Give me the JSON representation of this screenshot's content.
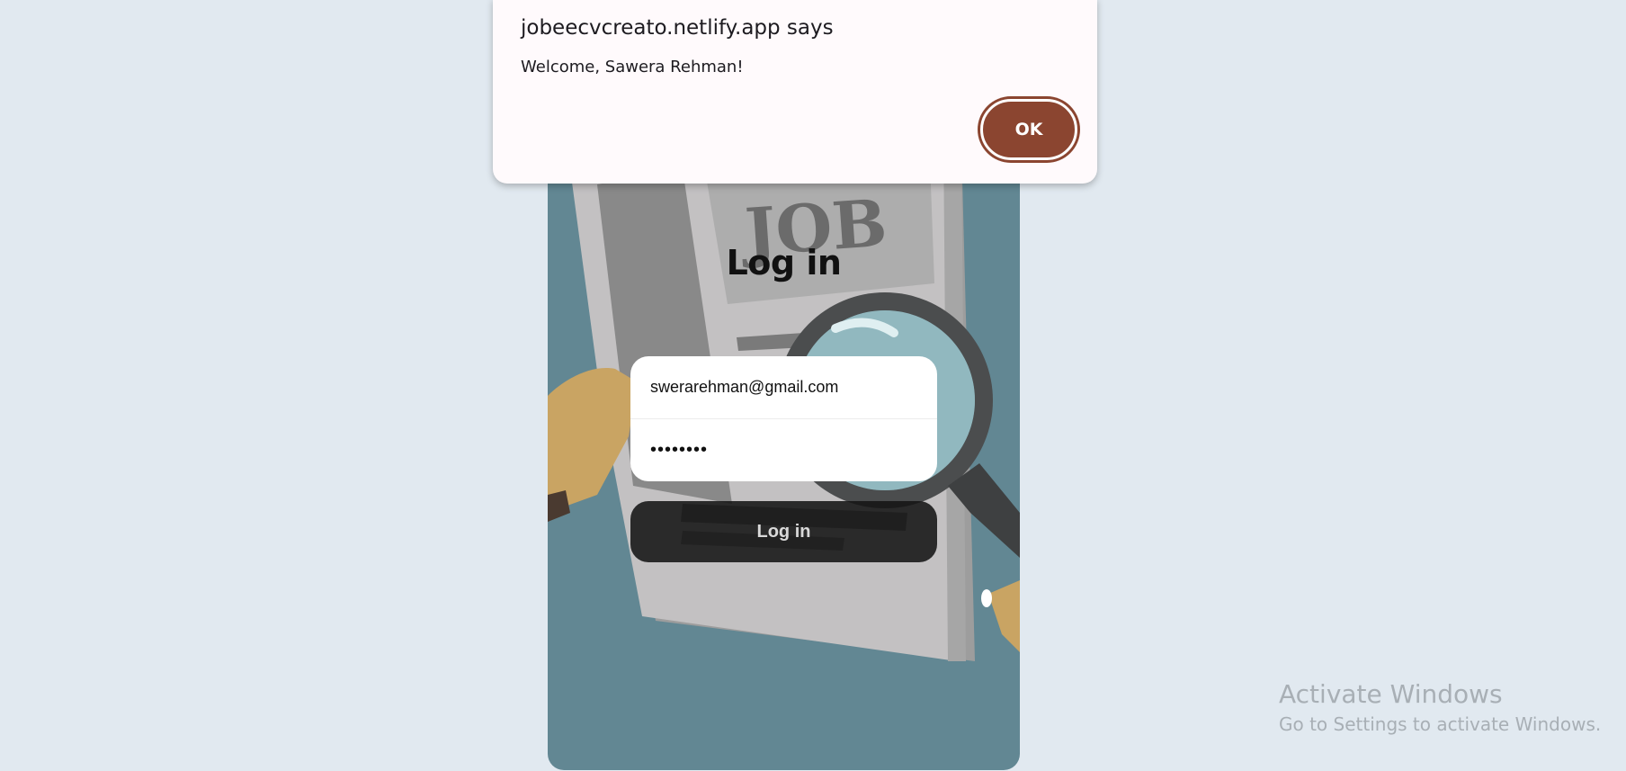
{
  "dialog": {
    "title": "jobeecvcreato.netlify.app says",
    "message": "Welcome, Sawera Rehman!",
    "ok_label": "OK"
  },
  "login": {
    "title": "Log in",
    "email_value": "swerarehman@gmail.com",
    "password_value": "********",
    "submit_label": "Log in"
  },
  "watermark": {
    "title": "Activate Windows",
    "subtitle": "Go to Settings to activate Windows."
  },
  "illustration": {
    "newspaper_headline": "JOB"
  },
  "colors": {
    "page_background": "#e1e9f0",
    "card_background": "#628793",
    "ok_button": "#8b4530",
    "dialog_background": "#fffafc"
  }
}
